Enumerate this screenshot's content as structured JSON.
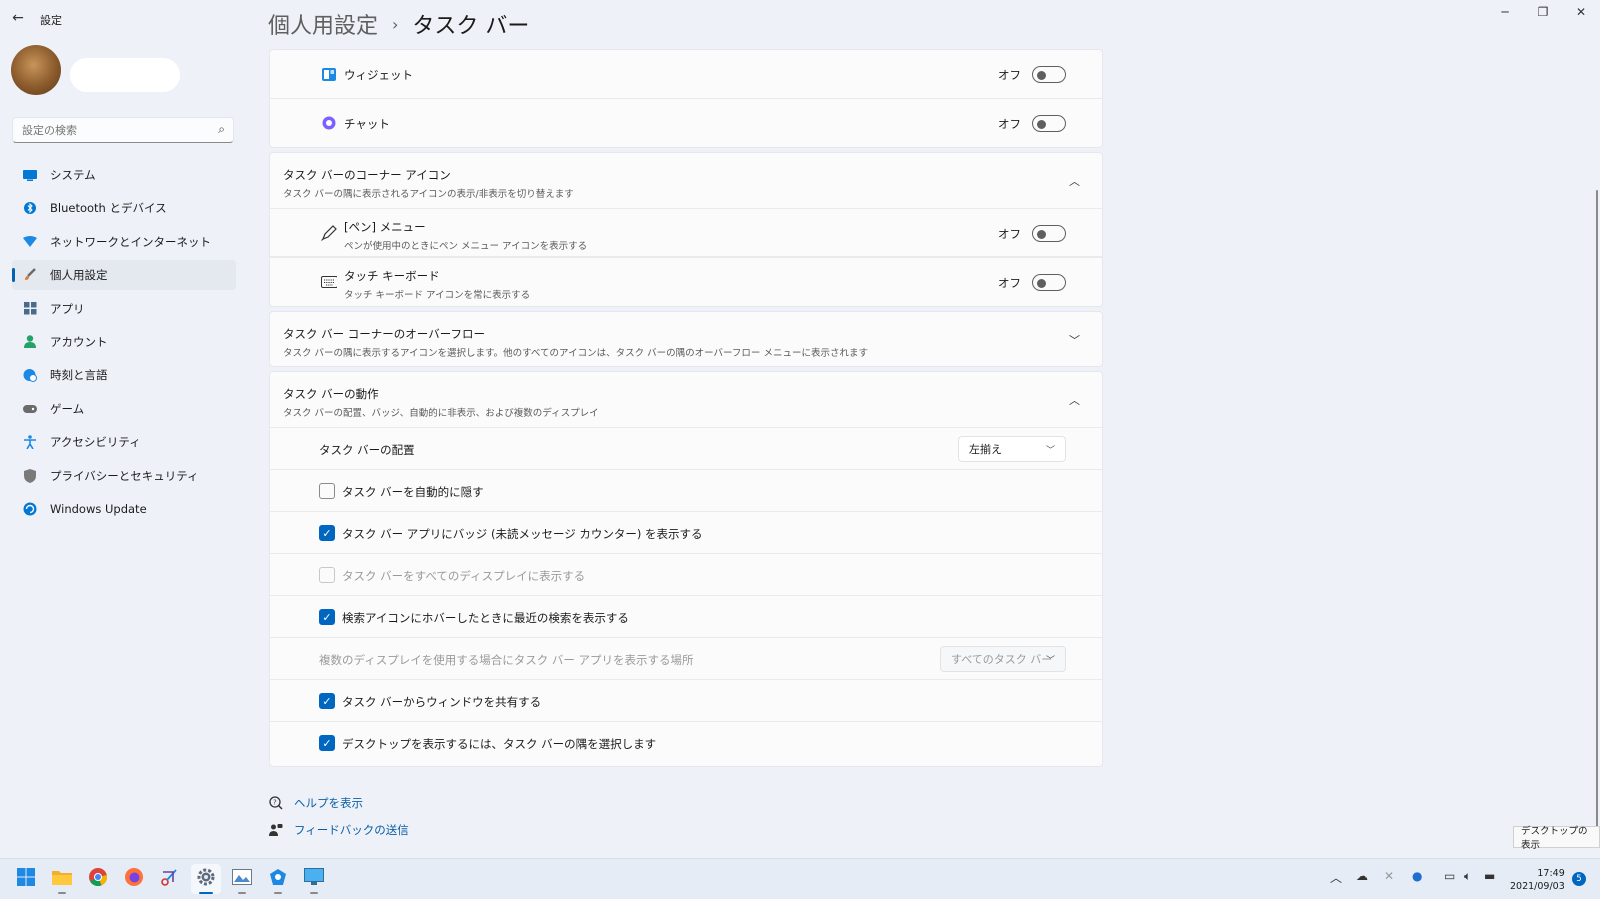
{
  "window": {
    "app_title": "設定"
  },
  "search": {
    "placeholder": "設定の検索"
  },
  "sidebar": {
    "items": [
      {
        "label": "システム",
        "icon": "monitor-icon",
        "color": "#0067c0"
      },
      {
        "label": "Bluetooth とデバイス",
        "icon": "bluetooth-icon",
        "color": "#0078d4"
      },
      {
        "label": "ネットワークとインターネット",
        "icon": "wifi-icon",
        "color": "#1e88e5"
      },
      {
        "label": "個人用設定",
        "icon": "brush-icon",
        "color": "#d47a3a",
        "active": true
      },
      {
        "label": "アプリ",
        "icon": "apps-icon",
        "color": "#4a6b8a"
      },
      {
        "label": "アカウント",
        "icon": "person-icon",
        "color": "#26a269"
      },
      {
        "label": "時刻と言語",
        "icon": "globe-clock-icon",
        "color": "#1e88e5"
      },
      {
        "label": "ゲーム",
        "icon": "gamepad-icon",
        "color": "#6b6b6b"
      },
      {
        "label": "アクセシビリティ",
        "icon": "accessibility-icon",
        "color": "#1e88e5"
      },
      {
        "label": "プライバシーとセキュリティ",
        "icon": "shield-icon",
        "color": "#7a7a7a"
      },
      {
        "label": "Windows Update",
        "icon": "update-icon",
        "color": "#0078d4"
      }
    ]
  },
  "header": {
    "parent": "個人用設定",
    "separator": "›",
    "current": "タスク バー"
  },
  "items_panel": {
    "rows": [
      {
        "title": "ウィジェット",
        "icon": "widgets-icon",
        "state": "オフ"
      },
      {
        "title": "チャット",
        "icon": "chat-icon",
        "state": "オフ"
      }
    ]
  },
  "corner_icons": {
    "title": "タスク バーのコーナー アイコン",
    "subtitle": "タスク バーの隅に表示されるアイコンの表示/非表示を切り替えます",
    "rows": [
      {
        "title": "[ペン] メニュー",
        "subtitle": "ペンが使用中のときにペン メニュー アイコンを表示する",
        "icon": "pen-icon",
        "state": "オフ"
      },
      {
        "title": "タッチ キーボード",
        "subtitle": "タッチ キーボード アイコンを常に表示する",
        "icon": "keyboard-icon",
        "state": "オフ"
      }
    ]
  },
  "overflow": {
    "title": "タスク バー コーナーのオーバーフロー",
    "subtitle": "タスク バーの隅に表示するアイコンを選択します。他のすべてのアイコンは、タスク バーの隅のオーバーフロー メニューに表示されます"
  },
  "behaviors": {
    "title": "タスク バーの動作",
    "subtitle": "タスク バーの配置、バッジ、自動的に非表示、および複数のディスプレイ",
    "alignment_label": "タスク バーの配置",
    "alignment_value": "左揃え",
    "options": [
      {
        "label": "タスク バーを自動的に隠す",
        "checked": false,
        "disabled": false
      },
      {
        "label": "タスク バー アプリにバッジ (未読メッセージ カウンター) を表示する",
        "checked": true,
        "disabled": false
      },
      {
        "label": "タスク バーをすべてのディスプレイに表示する",
        "checked": false,
        "disabled": true
      },
      {
        "label": "検索アイコンにホバーしたときに最近の検索を表示する",
        "checked": true,
        "disabled": false
      }
    ],
    "multi_display_label": "複数のディスプレイを使用する場合にタスク バー アプリを表示する場所",
    "multi_display_value": "すべてのタスク バー",
    "options2": [
      {
        "label": "タスク バーからウィンドウを共有する",
        "checked": true
      },
      {
        "label": "デスクトップを表示するには、タスク バーの隅を選択します",
        "checked": true
      }
    ]
  },
  "links": {
    "help": "ヘルプを表示",
    "feedback": "フィードバックの送信"
  },
  "tooltip": "デスクトップの表示",
  "taskbar": {
    "clock_time": "17:49",
    "clock_date": "2021/09/03",
    "notification_count": "5"
  }
}
